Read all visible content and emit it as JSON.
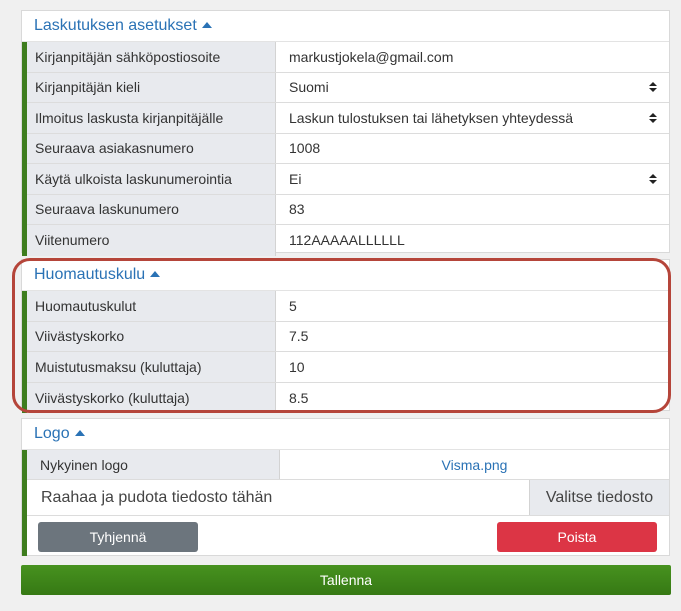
{
  "billing": {
    "title": "Laskutuksen asetukset",
    "rows": [
      {
        "label": "Kirjanpitäjän sähköpostiosoite",
        "value": "markustjokela@gmail.com"
      },
      {
        "label": "Kirjanpitäjän kieli",
        "value": "Suomi"
      },
      {
        "label": "Ilmoitus laskusta kirjanpitäjälle",
        "value": "Laskun tulostuksen tai lähetyksen yhteydessä"
      },
      {
        "label": "Seuraava asiakasnumero",
        "value": "1008"
      },
      {
        "label": "Käytä ulkoista laskunumerointia",
        "value": "Ei"
      },
      {
        "label": "Seuraava laskunumero",
        "value": "83"
      },
      {
        "label": "Viitenumero",
        "value": "112AAAAALLLLLL"
      }
    ]
  },
  "reminder": {
    "title": "Huomautuskulu",
    "rows": [
      {
        "label": "Huomautuskulut",
        "value": "5"
      },
      {
        "label": "Viivästyskorko",
        "value": "7.5"
      },
      {
        "label": "Muistutusmaksu (kuluttaja)",
        "value": "10"
      },
      {
        "label": "Viivästyskorko (kuluttaja)",
        "value": "8.5"
      }
    ]
  },
  "logo": {
    "title": "Logo",
    "current_label": "Nykyinen logo",
    "current_file": "Visma.png",
    "drop_text": "Raahaa ja pudota tiedosto tähän",
    "browse_label": "Valitse tiedosto",
    "clear_label": "Tyhjennä",
    "delete_label": "Poista"
  },
  "save_label": "Tallenna",
  "colors": {
    "accent_green": "#3e7d1e",
    "header_blue": "#2a72b5",
    "highlight_red": "#b5453a",
    "delete_red": "#dc3545",
    "clear_gray": "#6c757d"
  }
}
